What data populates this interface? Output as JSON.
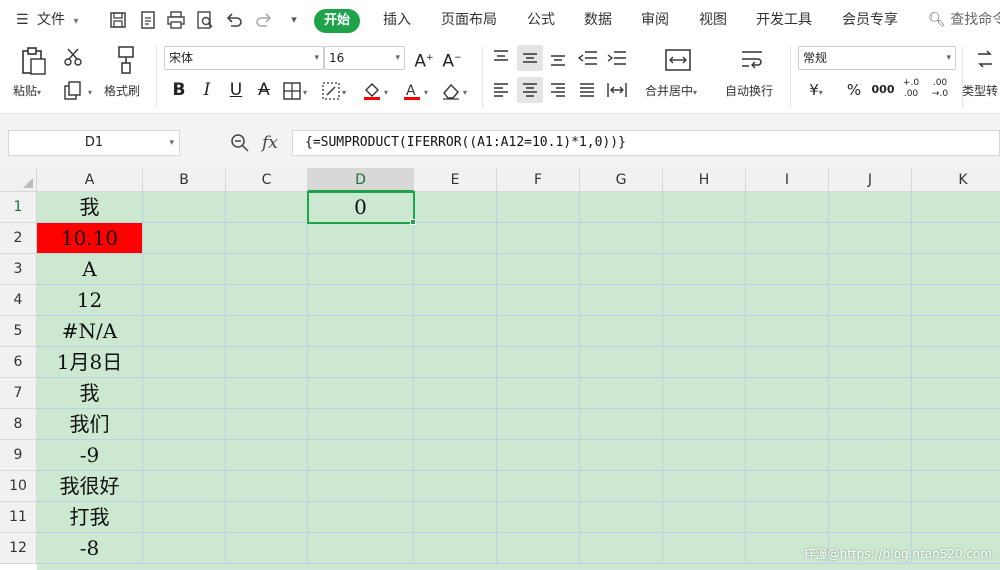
{
  "menu": {
    "file_label": "文件",
    "tabs": [
      "开始",
      "插入",
      "页面布局",
      "公式",
      "数据",
      "审阅",
      "视图",
      "开发工具",
      "会员专享"
    ],
    "active_tab": "开始",
    "search_label": "查找命令"
  },
  "ribbon": {
    "paste_label": "粘贴",
    "format_painter_label": "格式刷",
    "font_name": "宋体",
    "font_size": "16",
    "merge_center_label": "合并居中",
    "wrap_text_label": "自动换行",
    "number_format": "常规",
    "type_convert_label": "类型转",
    "currency_symbol": "¥",
    "percent_symbol": "%",
    "thousands_symbol": "000",
    "increase_decimal": "+.0 .00",
    "decrease_decimal": ".00 →.0"
  },
  "formula_bar": {
    "name_box": "D1",
    "fx_label": "fx",
    "formula": "{=SUMPRODUCT(IFERROR((A1:A12=10.1)*1,0))}"
  },
  "columns": [
    "A",
    "B",
    "C",
    "D",
    "E",
    "F",
    "G",
    "H",
    "I",
    "J",
    "K"
  ],
  "selected_column": "D",
  "rows": [
    "1",
    "2",
    "3",
    "4",
    "5",
    "6",
    "7",
    "8",
    "9",
    "10",
    "11",
    "12"
  ],
  "column_a_values": [
    "我",
    "10.10",
    "A",
    "12",
    "#N/A",
    "1月8日",
    "我",
    "我们",
    "-9",
    "我很好",
    "打我",
    "-8"
  ],
  "d1_value": "0",
  "highlight_color": "#ff0000",
  "accent_color": "#1fa34a",
  "sheet_bg_color": "#cde8d1",
  "watermark": "梓潼@https://blog.ntan520.com"
}
